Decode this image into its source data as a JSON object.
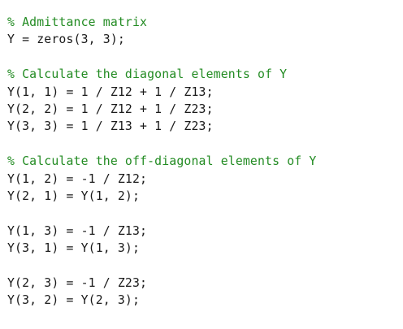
{
  "editor": {
    "colors": {
      "background": "#ffffff",
      "code_text": "#1a1a1a",
      "comment": "#228b22"
    },
    "lines": [
      {
        "kind": "comment",
        "text": "% Admittance matrix"
      },
      {
        "kind": "code",
        "text": "Y = zeros(3, 3);"
      },
      {
        "kind": "blank",
        "text": ""
      },
      {
        "kind": "comment",
        "text": "% Calculate the diagonal elements of Y"
      },
      {
        "kind": "code",
        "text": "Y(1, 1) = 1 / Z12 + 1 / Z13;"
      },
      {
        "kind": "code",
        "text": "Y(2, 2) = 1 / Z12 + 1 / Z23;"
      },
      {
        "kind": "code",
        "text": "Y(3, 3) = 1 / Z13 + 1 / Z23;"
      },
      {
        "kind": "blank",
        "text": ""
      },
      {
        "kind": "comment",
        "text": "% Calculate the off-diagonal elements of Y"
      },
      {
        "kind": "code",
        "text": "Y(1, 2) = -1 / Z12;"
      },
      {
        "kind": "code",
        "text": "Y(2, 1) = Y(1, 2);"
      },
      {
        "kind": "blank",
        "text": ""
      },
      {
        "kind": "code",
        "text": "Y(1, 3) = -1 / Z13;"
      },
      {
        "kind": "code",
        "text": "Y(3, 1) = Y(1, 3);"
      },
      {
        "kind": "blank",
        "text": ""
      },
      {
        "kind": "code",
        "text": "Y(2, 3) = -1 / Z23;"
      },
      {
        "kind": "code",
        "text": "Y(3, 2) = Y(2, 3);"
      }
    ]
  }
}
